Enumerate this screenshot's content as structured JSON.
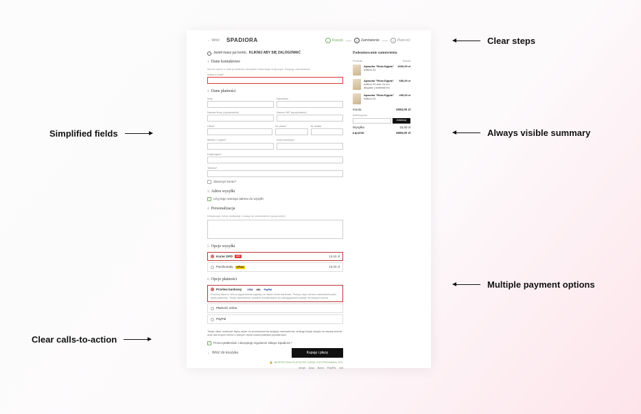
{
  "annotations": {
    "clear_steps": "Clear steps",
    "simplified_fields": "Simplified fields",
    "always_visible_summary": "Always visible summary",
    "multiple_payment": "Multiple payment options",
    "clear_cta": "Clear calls-to-action"
  },
  "topbar": {
    "back": "← Wróć",
    "logo": "SPADIORA"
  },
  "steps": {
    "s1": "Koszyk",
    "s2": "Zamówienie",
    "s3": "Płatność",
    "n2": "2",
    "n3": "3"
  },
  "login_prompt": {
    "prefix": "Jeżeli masz już konto,",
    "action": "KLIKNIJ ABY SIĘ ZALOGOWAĆ"
  },
  "sections": {
    "s1_title": "Dane kontaktowe",
    "s1_hint": "Na ten adres e-mail prześlemy wszystkie informacje dotyczące Twojego zamówienia.",
    "s1_email_label": "Adres e-mail*",
    "s2_title": "Dane płatności",
    "s2_fname": "Imię",
    "s2_lname": "Nazwisko",
    "s2_company": "Nazwa firmy (opcjonalnie)",
    "s2_nip": "Numer NIP (opcjonalnie)",
    "s2_street": "Ulica*",
    "s2_house": "Nr domu*",
    "s2_apt": "Nr lokalu",
    "s2_city": "Miasto / region*",
    "s2_zip": "Kod pocztowy*",
    "s2_country": "Kraj/region*",
    "s2_phone": "Telefon*",
    "s2_create": "Stworzyć konto?",
    "s3_title": "Adres wysyłki",
    "s3_same": "Użyj tego samego adresu do wysyłki",
    "s4_title": "Personalizacja",
    "s4_hint": "Dedykacja / tekst dedykacji | Uwagi do zamówienia (opcjonalne)",
    "s5_title": "Opcje wysyłki",
    "s5_opt1_name": "Kurier DPD",
    "s5_opt1_badge": "dpd",
    "s5_opt1_price": "15,00 zł",
    "s5_opt2_name": "Paczkomaty",
    "s5_opt2_badge": "InPost",
    "s5_opt2_price": "15,00 zł",
    "s6_title": "Opcje płatności",
    "s6_opt1_name": "Przelew bankowy",
    "s6_opt1_desc": "Prosimy dane w celu przygotowania wypłaty na nasze konto bankowe. Proszę użyć numeru zamówienia jako tytułu płatności. Twoje zamówienie zostanie zrealizowane po zaksięgowaniu wpłaty na naszym koncie.",
    "s6_opt2_name": "Płatność online",
    "s6_opt3_name": "PayPal"
  },
  "pay_logos": {
    "visa": "VISA",
    "blik": "blik",
    "pp": "PayPal"
  },
  "terms": {
    "line": "Twoje dane osobowe będą użyte do przetworzenia twojego zamówienia, obsługi twojej wizyty na naszej stronie oraz dla innych celów o których mówi nasza polityka prywatności.",
    "chk": "Przeczytałem/am i akceptuję regulamin sklepu Spadiora *"
  },
  "footer": {
    "back": "Wróć do koszyka",
    "cta": "Kupuję i płacę",
    "secure": "BEZPIECZNA PŁATNOŚĆ DZIĘKI SZYFROWANIU SSL",
    "logos": {
      "stripe": "stripe",
      "tpay": "tpay",
      "pbank": "Bank",
      "pp": "PayPal",
      "dot": "dot"
    }
  },
  "summary": {
    "title": "Podsumowanie zamówienia",
    "col_prod": "Produkt",
    "col_qty": "Kwota",
    "items": [
      {
        "name": "Apaszka \"Róża Egiptu\"",
        "sub": "edition 24",
        "price": "1600,00 zł"
      },
      {
        "name": "Apaszka \"Róża Egiptu\"",
        "sub": "edition 24 size 24 cm długość | materiał len",
        "price": "656,00 zł"
      },
      {
        "name": "Apaszka \"Róża Egiptu\"",
        "sub": "edition 24",
        "price": "299,00 zł"
      }
    ],
    "subtotal_label": "Kwota",
    "subtotal": "2550,00 zł",
    "coupon_label": "Kod kuponu",
    "coupon_btn": "Zastosuj",
    "ship_label": "Wysyłka",
    "ship_val": "15,00 zł",
    "total_label": "Łącznie",
    "total": "2565,00 zł"
  }
}
